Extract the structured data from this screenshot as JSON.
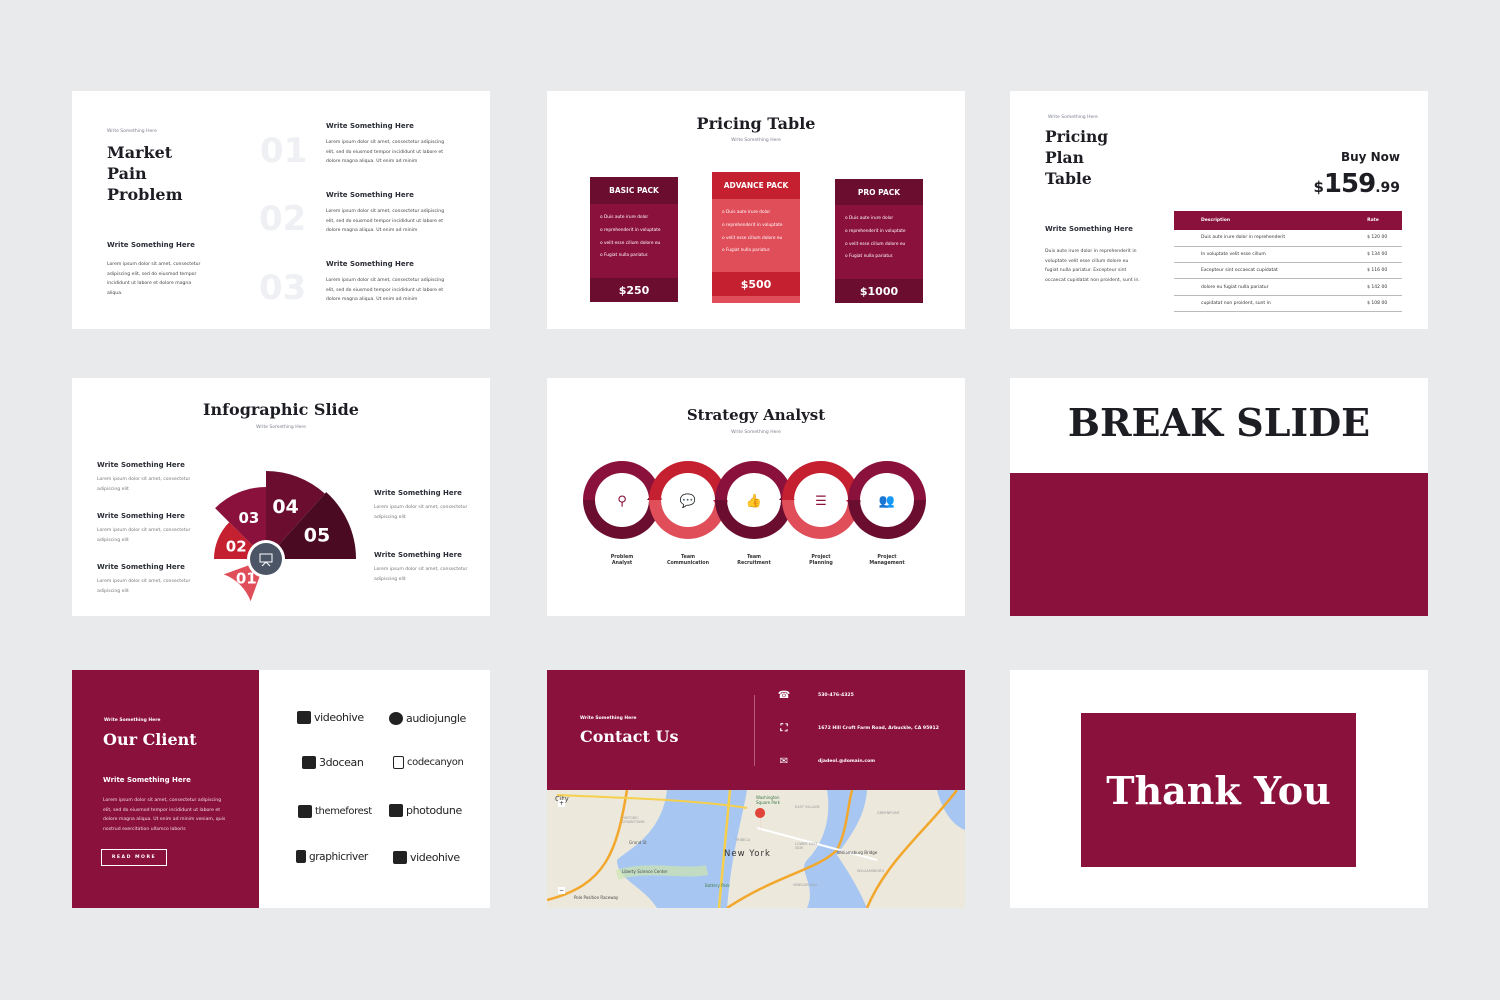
{
  "colors": {
    "crimson": "#8b113d",
    "dark": "#6a0d2f",
    "red": "#c5202f",
    "light_red": "#e04e5a",
    "background": "#e9eaec"
  },
  "slide1": {
    "kicker": "Write Something Here",
    "title_lines": [
      "Market",
      "Pain",
      "Problem"
    ],
    "sub_heading": "Write Something Here",
    "body": "Lorem ipsum dolor sit amet, consectetur adipiscing elit, sed do eiusmod tempor incididunt ut labore et dolore magna aliqua.",
    "items": [
      {
        "num": "01",
        "heading": "Write Something Here",
        "text": "Lorem ipsum dolor sit amet, consectetur adipiscing elit, sed do eiusmod tempor incididunt ut labore et dolore magna aliqua. Ut enim ad minim"
      },
      {
        "num": "02",
        "heading": "Write Something Here",
        "text": "Lorem ipsum dolor sit amet, consectetur adipiscing elit, sed do eiusmod tempor incididunt ut labore et dolore magna aliqua. Ut enim ad minim"
      },
      {
        "num": "03",
        "heading": "Write Something Here",
        "text": "Lorem ipsum dolor sit amet, consectetur adipiscing elit, sed do eiusmod tempor incididunt ut labore et dolore magna aliqua. Ut enim ad minim"
      }
    ]
  },
  "slide2": {
    "title": "Pricing Table",
    "subtitle": "Write Something Here",
    "packs": [
      {
        "name": "BASIC PACK",
        "features": [
          "Duis aute irure dolor",
          "reprehenderit in voluptate",
          "velit esse cillum dolore eu",
          "Fugiat nulla pariatur."
        ],
        "price": "$250"
      },
      {
        "name": "ADVANCE PACK",
        "features": [
          "Duis aute irure dolor",
          "reprehenderit in voluptate",
          "velit esse cillum dolore eu",
          "Fugiat nulla pariatur."
        ],
        "price": "$500"
      },
      {
        "name": "PRO PACK",
        "features": [
          "Duis aute irure dolor",
          "reprehenderit in voluptate",
          "velit esse cillum dolore eu",
          "Fugiat nulla pariatur."
        ],
        "price": "$1000"
      }
    ]
  },
  "slide3": {
    "kicker": "Write Something Here",
    "title_lines": [
      "Pricing",
      "Plan",
      "Table"
    ],
    "buy_now": "Buy Now",
    "price_currency": "$",
    "price_main": "159",
    "price_cents": ".99",
    "sub_heading": "Write Something Here",
    "body": "Duis aute irure dolor in reprehenderit in voluptate velit esse cillum dolore eu fugiat nulla pariatur. Excepteur sint occaecat cupidatat non proident, sunt in.",
    "table": {
      "headers": [
        "Description",
        "Rate"
      ],
      "rows": [
        [
          "Duis aute irure dolor in reprehenderit",
          "$ 120 00"
        ],
        [
          "In voluptate velit esse cillum",
          "$ 134 00"
        ],
        [
          "Excepteur sint occaecat cupidatat",
          "$ 116 00"
        ],
        [
          "dolore eu fugiat nulla pariatur",
          "$ 142 00"
        ],
        [
          "cupidatat non proident, sunt in",
          "$ 108 00"
        ]
      ]
    }
  },
  "slide4": {
    "title": "Infographic Slide",
    "subtitle": "Write Something Here",
    "segments": [
      "01",
      "02",
      "03",
      "04",
      "05"
    ],
    "center_icon": "presentation-board-icon",
    "left_items": [
      {
        "heading": "Write Something Here",
        "text": "Lorem ipsum dolor sit amet, consectetur adipiscing elit"
      },
      {
        "heading": "Write Something Here",
        "text": "Lorem ipsum dolor sit amet, consectetur adipiscing elit"
      },
      {
        "heading": "Write Something Here",
        "text": "Lorem ipsum dolor sit amet, consectetur adipiscing elit"
      }
    ],
    "right_items": [
      {
        "heading": "Write Something Here",
        "text": "Lorem ipsum dolor sit amet, consectetur adipiscing elit"
      },
      {
        "heading": "Write Something Here",
        "text": "Lorem ipsum dolor sit amet, consectetur adipiscing elit"
      }
    ]
  },
  "slide5": {
    "title": "Strategy Analyst",
    "subtitle": "Write Something Here",
    "steps": [
      {
        "label_lines": [
          "Problem",
          "Analyst"
        ],
        "icon": "magnifier-icon",
        "glyph": "⚲"
      },
      {
        "label_lines": [
          "Team",
          "Communication"
        ],
        "icon": "chat-bubbles-icon",
        "glyph": "💬"
      },
      {
        "label_lines": [
          "Team",
          "Recruitment"
        ],
        "icon": "thumbs-up-icon",
        "glyph": "👍"
      },
      {
        "label_lines": [
          "Project",
          "Planning"
        ],
        "icon": "list-card-icon",
        "glyph": "☰"
      },
      {
        "label_lines": [
          "Project",
          "Management"
        ],
        "icon": "users-icon",
        "glyph": "👥"
      }
    ]
  },
  "slide6": {
    "title": "BREAK SLIDE"
  },
  "slide7": {
    "kicker": "Write Something Here",
    "title": "Our Client",
    "sub_heading": "Write Something Here",
    "body": "Lorem ipsum dolor sit amet, consectetur adipiscing elit, sed do eiusmod tempor incididunt ut labore et dolore magna aliqua. Ut enim ad minim veniam, quis nostrud exercitation ullamco laboris",
    "button": "READ MORE",
    "logos": [
      "videohive",
      "audiojungle",
      "3docean",
      "codecanyon",
      "themeforest",
      "photodune",
      "graphicriver",
      "videohive"
    ]
  },
  "slide8": {
    "kicker": "Write Something Here",
    "title": "Contact Us",
    "phone": "530-476-4325",
    "address": "1672 Hill Croft Farm Road, Arbuckle, CA 95912",
    "email": "djadeol.@domain.com",
    "map_labels": [
      "City",
      "Washington Square Park",
      "EAST VILLAGE",
      "HISTORIC DOWNTOWN",
      "Grand St",
      "TRIBECA",
      "New York",
      "LOWER EAST SIDE",
      "Williamsburg Bridge",
      "Liberty Science Center",
      "Battery Park",
      "WILLIAMSBURG",
      "GREENPOINT",
      "VINEGAR HILL",
      "Pole Position Raceway"
    ]
  },
  "slide9": {
    "title": "Thank You"
  }
}
